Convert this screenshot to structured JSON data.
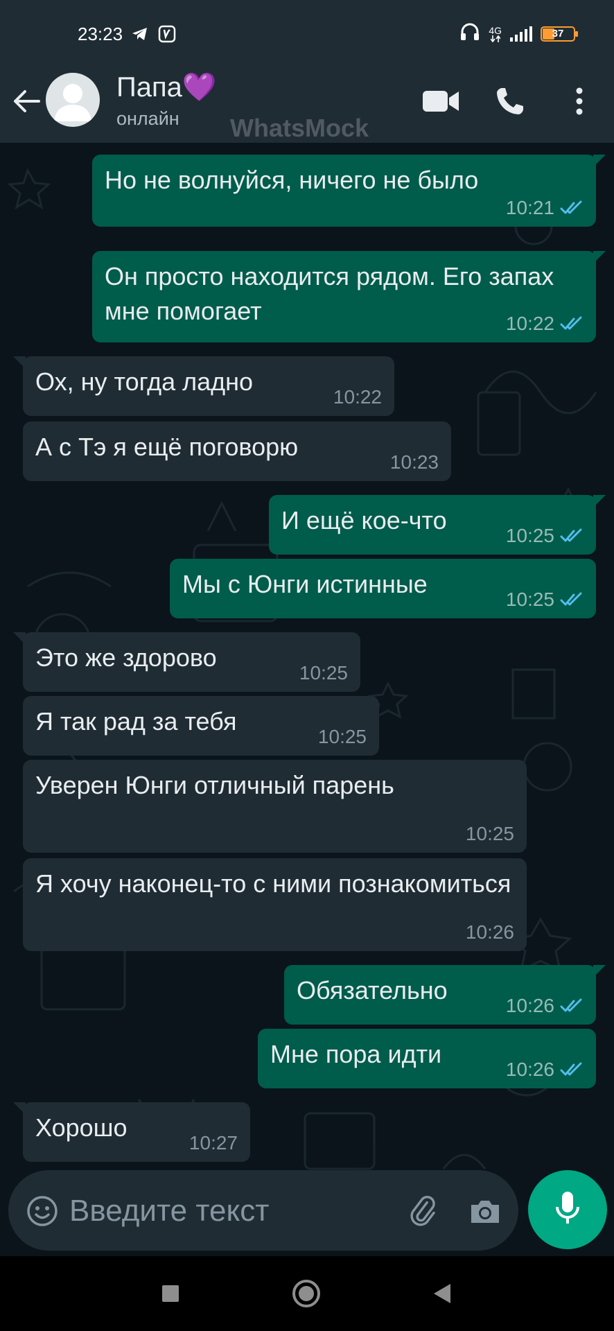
{
  "status_bar": {
    "time": "23:23",
    "network": "4G",
    "battery": "37",
    "icons": [
      "telegram-icon",
      "app-notification-icon",
      "headphones-icon",
      "signal-icon",
      "battery-icon"
    ]
  },
  "header": {
    "contact_name": "Папа💜",
    "contact_status": "онлайн",
    "watermark": "WhatsMock",
    "icons": [
      "back-arrow-icon",
      "video-call-icon",
      "phone-icon",
      "more-vert-icon"
    ]
  },
  "messages": [
    {
      "direction": "out",
      "text": "Но не волнуйся, ничего не было",
      "time": "10:21",
      "read": true
    },
    {
      "direction": "out",
      "text": "Он просто находится рядом. Его запах мне помогает",
      "time": "10:22",
      "read": true
    },
    {
      "direction": "in",
      "text": "Ох, ну тогда ладно",
      "time": "10:22"
    },
    {
      "direction": "in",
      "text": "А с Тэ я ещё поговорю",
      "time": "10:23"
    },
    {
      "direction": "out",
      "text": "И ещё кое-что",
      "time": "10:25",
      "read": true
    },
    {
      "direction": "out",
      "text": "Мы с Юнги истинные",
      "time": "10:25",
      "read": true
    },
    {
      "direction": "in",
      "text": "Это же здорово",
      "time": "10:25"
    },
    {
      "direction": "in",
      "text": "Я так рад за тебя",
      "time": "10:25"
    },
    {
      "direction": "in",
      "text": "Уверен Юнги отличный парень",
      "time": "10:25"
    },
    {
      "direction": "in",
      "text": "Я хочу наконец-то с ними познакомиться",
      "time": "10:26"
    },
    {
      "direction": "out",
      "text": "Обязательно",
      "time": "10:26",
      "read": true
    },
    {
      "direction": "out",
      "text": "Мне пора идти",
      "time": "10:26",
      "read": true
    },
    {
      "direction": "in",
      "text": "Хорошо",
      "time": "10:27"
    }
  ],
  "composer": {
    "placeholder": "Введите текст",
    "icons": [
      "emoji-icon",
      "attach-icon",
      "camera-icon",
      "mic-icon"
    ]
  },
  "colors": {
    "background": "#0b141a",
    "bar": "#1f2c34",
    "incoming_bubble": "#1f2c34",
    "outgoing_bubble": "#005c4b",
    "read_ticks": "#53bdeb",
    "accent": "#00a884"
  }
}
